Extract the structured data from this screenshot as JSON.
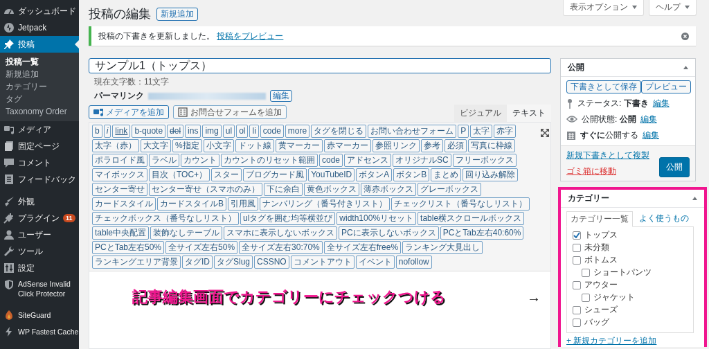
{
  "sidebar": {
    "groups": [
      {
        "items": [
          {
            "label": "ダッシュボード",
            "selected": false
          },
          {
            "label": "Jetpack",
            "selected": false
          }
        ]
      },
      {
        "items": [
          {
            "label": "投稿",
            "selected": true,
            "children": [
              {
                "label": "投稿一覧",
                "selected": true
              },
              {
                "label": "新規追加",
                "selected": false
              },
              {
                "label": "カテゴリー",
                "selected": false
              },
              {
                "label": "タグ",
                "selected": false
              },
              {
                "label": "Taxonomy Order",
                "selected": false
              }
            ]
          },
          {
            "label": "メディア",
            "selected": false
          },
          {
            "label": "固定ページ",
            "selected": false
          },
          {
            "label": "コメント",
            "selected": false
          },
          {
            "label": "フィードバック",
            "selected": false
          }
        ]
      },
      {
        "items": [
          {
            "label": "外観",
            "selected": false
          },
          {
            "label": "プラグイン",
            "selected": false,
            "badge": "11"
          },
          {
            "label": "ユーザー",
            "selected": false
          },
          {
            "label": "ツール",
            "selected": false
          },
          {
            "label": "設定",
            "selected": false
          },
          {
            "label": "AdSense Invalid Click Protector",
            "selected": false
          }
        ]
      },
      {
        "items": [
          {
            "label": "SiteGuard",
            "selected": false
          },
          {
            "label": "WP Fastest Cache",
            "selected": false
          }
        ]
      }
    ]
  },
  "screen_meta": [
    "表示オプション",
    "ヘルプ"
  ],
  "page_title": "投稿の編集",
  "add_new_button": "新規追加",
  "notice": {
    "message": "投稿の下書きを更新しました。",
    "link": "投稿をプレビュー"
  },
  "post_title": "サンプル1（トップス）",
  "char_count": "現在文字数：11文字",
  "permalink": {
    "label": "パーマリンク",
    "edit_button": "編集"
  },
  "media_buttons": [
    "メディアを追加",
    "お問合せフォームを追加"
  ],
  "editor_tabs": [
    {
      "label": "ビジュアル",
      "selected": false
    },
    {
      "label": "テキスト",
      "selected": true
    }
  ],
  "quicktags": [
    {
      "label": "b",
      "kind": "bold"
    },
    {
      "label": "i",
      "kind": "italic"
    },
    {
      "label": "link",
      "kind": "link"
    },
    {
      "label": "b-quote",
      "kind": "plain"
    },
    {
      "label": "del",
      "kind": "del"
    },
    {
      "label": "ins",
      "kind": "plain"
    },
    {
      "label": "img",
      "kind": "plain"
    },
    {
      "label": "ul",
      "kind": "plain"
    },
    {
      "label": "ol",
      "kind": "plain"
    },
    {
      "label": "li",
      "kind": "plain"
    },
    {
      "label": "code",
      "kind": "plain"
    },
    {
      "label": "more",
      "kind": "plain"
    },
    {
      "label": "タグを閉じる",
      "kind": "plain"
    },
    {
      "label": "お問い合わせフォーム",
      "kind": "plain"
    },
    {
      "label": "P",
      "kind": "plain"
    },
    {
      "label": "太字",
      "kind": "plain"
    },
    {
      "label": "赤字",
      "kind": "plain"
    },
    {
      "label": "太字（赤）",
      "kind": "plain"
    },
    {
      "label": "大文字",
      "kind": "plain"
    },
    {
      "label": "%指定",
      "kind": "plain"
    },
    {
      "label": "小文字",
      "kind": "plain"
    },
    {
      "label": "ドット線",
      "kind": "plain"
    },
    {
      "label": "黄マーカー",
      "kind": "plain"
    },
    {
      "label": "赤マーカー",
      "kind": "plain"
    },
    {
      "label": "参照リンク",
      "kind": "plain"
    },
    {
      "label": "参考",
      "kind": "plain"
    },
    {
      "label": "必須",
      "kind": "plain"
    },
    {
      "label": "写真に枠線",
      "kind": "plain"
    },
    {
      "label": "ポラロイド風",
      "kind": "plain"
    },
    {
      "label": "ラベル",
      "kind": "plain"
    },
    {
      "label": "カウント",
      "kind": "plain"
    },
    {
      "label": "カウントのリセット範囲",
      "kind": "plain"
    },
    {
      "label": "code",
      "kind": "plain"
    },
    {
      "label": "アドセンス",
      "kind": "plain"
    },
    {
      "label": "オリジナルSC",
      "kind": "plain"
    },
    {
      "label": "フリーボックス",
      "kind": "plain"
    },
    {
      "label": "マイボックス",
      "kind": "plain"
    },
    {
      "label": "目次（TOC+）",
      "kind": "plain"
    },
    {
      "label": "スター",
      "kind": "plain"
    },
    {
      "label": "ブログカード風",
      "kind": "plain"
    },
    {
      "label": "YouTubeID",
      "kind": "plain"
    },
    {
      "label": "ボタンA",
      "kind": "plain"
    },
    {
      "label": "ボタンB",
      "kind": "plain"
    },
    {
      "label": "まとめ",
      "kind": "plain"
    },
    {
      "label": "回り込み解除",
      "kind": "plain"
    },
    {
      "label": "センター寄せ",
      "kind": "plain"
    },
    {
      "label": "センター寄せ（スマホのみ）",
      "kind": "plain"
    },
    {
      "label": "下に余白",
      "kind": "plain"
    },
    {
      "label": "黄色ボックス",
      "kind": "plain"
    },
    {
      "label": "薄赤ボックス",
      "kind": "plain"
    },
    {
      "label": "グレーボックス",
      "kind": "plain"
    },
    {
      "label": "カードスタイル",
      "kind": "plain"
    },
    {
      "label": "カードスタイルB",
      "kind": "plain"
    },
    {
      "label": "引用風",
      "kind": "plain"
    },
    {
      "label": "ナンバリング（番号付きリスト）",
      "kind": "plain"
    },
    {
      "label": "チェックリスト（番号なしリスト）",
      "kind": "plain"
    },
    {
      "label": "チェックボックス（番号なしリスト）",
      "kind": "plain"
    },
    {
      "label": "ulタグを囲む均等横並び",
      "kind": "plain"
    },
    {
      "label": "width100%リセット",
      "kind": "plain"
    },
    {
      "label": "table横スクロールボックス",
      "kind": "plain"
    },
    {
      "label": "table中央配置",
      "kind": "plain"
    },
    {
      "label": "装飾なしテーブル",
      "kind": "plain"
    },
    {
      "label": "スマホに表示しないボックス",
      "kind": "plain"
    },
    {
      "label": "PCに表示しないボックス",
      "kind": "plain"
    },
    {
      "label": "PCとTab左右40:60%",
      "kind": "plain"
    },
    {
      "label": "PCとTab左右50%",
      "kind": "plain"
    },
    {
      "label": "全サイズ左右50%",
      "kind": "plain"
    },
    {
      "label": "全サイズ左右30:70%",
      "kind": "plain"
    },
    {
      "label": "全サイズ左右free%",
      "kind": "plain"
    },
    {
      "label": "ランキング大見出し",
      "kind": "plain"
    },
    {
      "label": "ランキングエリア背景",
      "kind": "plain"
    },
    {
      "label": "タグID",
      "kind": "plain"
    },
    {
      "label": "タグSlug",
      "kind": "plain"
    },
    {
      "label": "CSSNO",
      "kind": "plain"
    },
    {
      "label": "コメントアウト",
      "kind": "plain"
    },
    {
      "label": "イベント",
      "kind": "plain"
    },
    {
      "label": "nofollow",
      "kind": "plain"
    }
  ],
  "annotation": {
    "text": "記事編集画面でカテゴリーにチェックつける",
    "arrow": "→"
  },
  "publish_box": {
    "title": "公開",
    "save_draft": "下書きとして保存",
    "preview": "プレビュー",
    "meta": [
      {
        "text": "ステータス: **下書き**",
        "link": "編集"
      },
      {
        "text": "公開状態: **公開**",
        "link": "編集"
      },
      {
        "text": "**すぐに**公開する",
        "link": "編集"
      }
    ],
    "copy_link": "新規下書きとして複製",
    "trash_link": "ゴミ箱に移動",
    "publish_button": "公開"
  },
  "category_box": {
    "title": "カテゴリー",
    "tabs": [
      {
        "label": "カテゴリー一覧",
        "selected": true
      },
      {
        "label": "よく使うもの",
        "selected": false
      }
    ],
    "items": [
      {
        "label": "トップス",
        "checked": true
      },
      {
        "label": "未分類",
        "checked": false
      },
      {
        "label": "ボトムス",
        "checked": false,
        "children": [
          {
            "label": "ショートパンツ",
            "checked": false
          }
        ]
      },
      {
        "label": "アウター",
        "checked": false,
        "children": [
          {
            "label": "ジャケット",
            "checked": false
          }
        ]
      },
      {
        "label": "シューズ",
        "checked": false
      },
      {
        "label": "バッグ",
        "checked": false
      }
    ],
    "add_link": "+ 新規カテゴリーを追加"
  }
}
